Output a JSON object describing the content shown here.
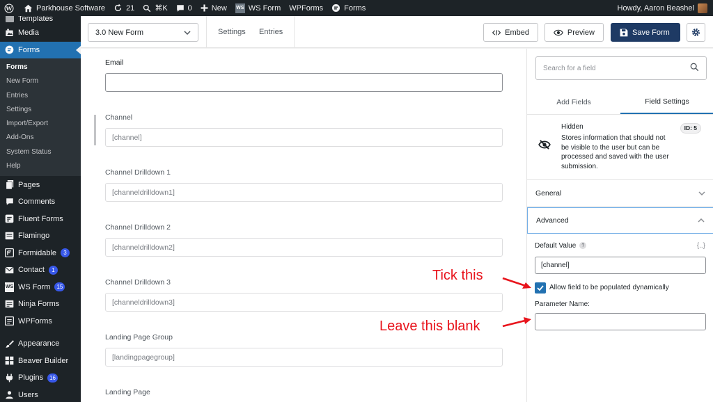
{
  "adminbar": {
    "site_name": "Parkhouse Software",
    "updates_count": "21",
    "shortcut": "⌘K",
    "comments_count": "0",
    "new_label": "New",
    "ws_form_label": "WS Form",
    "ws_badge": "WS",
    "wpforms_label": "WPForms",
    "forms_label": "Forms",
    "howdy": "Howdy, Aaron Beashel"
  },
  "sidebar": {
    "templates": "Templates",
    "media": "Media",
    "forms": "Forms",
    "submenu": [
      "Forms",
      "New Form",
      "Entries",
      "Settings",
      "Import/Export",
      "Add-Ons",
      "System Status",
      "Help"
    ],
    "pages": "Pages",
    "comments": "Comments",
    "fluent_forms": "Fluent Forms",
    "flamingo": "Flamingo",
    "formidable": "Formidable",
    "formidable_count": "3",
    "contact": "Contact",
    "contact_count": "1",
    "ws_form": "WS Form",
    "ws_form_count": "15",
    "ninja_forms": "Ninja Forms",
    "wpforms": "WPForms",
    "appearance": "Appearance",
    "beaver_builder": "Beaver Builder",
    "plugins": "Plugins",
    "plugins_count": "16",
    "users": "Users"
  },
  "toolbar": {
    "form_name": "3.0 New Form",
    "settings": "Settings",
    "entries": "Entries",
    "embed": "Embed",
    "preview": "Preview",
    "save": "Save Form"
  },
  "canvas": {
    "fields": [
      {
        "label": "Email",
        "value": ""
      },
      {
        "label": "Channel",
        "value": "[channel]"
      },
      {
        "label": "Channel Drilldown 1",
        "value": "[channeldrilldown1]"
      },
      {
        "label": "Channel Drilldown 2",
        "value": "[channeldrilldown2]"
      },
      {
        "label": "Channel Drilldown 3",
        "value": "[channeldrilldown3]"
      },
      {
        "label": "Landing Page Group",
        "value": "[landingpagegroup]"
      },
      {
        "label": "Landing Page",
        "value": ""
      }
    ]
  },
  "panel": {
    "search_placeholder": "Search for a field",
    "tab_add": "Add Fields",
    "tab_settings": "Field Settings",
    "field_title": "Hidden",
    "field_desc": "Stores information that should not be visible to the user but can be processed and saved with the user submission.",
    "field_id": "ID: 5",
    "general": "General",
    "advanced": "Advanced",
    "default_value_label": "Default Value",
    "help_mark": "?",
    "smart_tag": "{..}",
    "default_value": "[channel]",
    "dynamic_label": "Allow field to be populated dynamically",
    "param_label": "Parameter Name:",
    "param_value": ""
  },
  "annotations": {
    "tick": "Tick this",
    "blank": "Leave this blank"
  },
  "colors": {
    "accent": "#2271b1",
    "save_button": "#1e3a64",
    "annotation": "#e8141c",
    "admin_bg": "#1d2327"
  }
}
